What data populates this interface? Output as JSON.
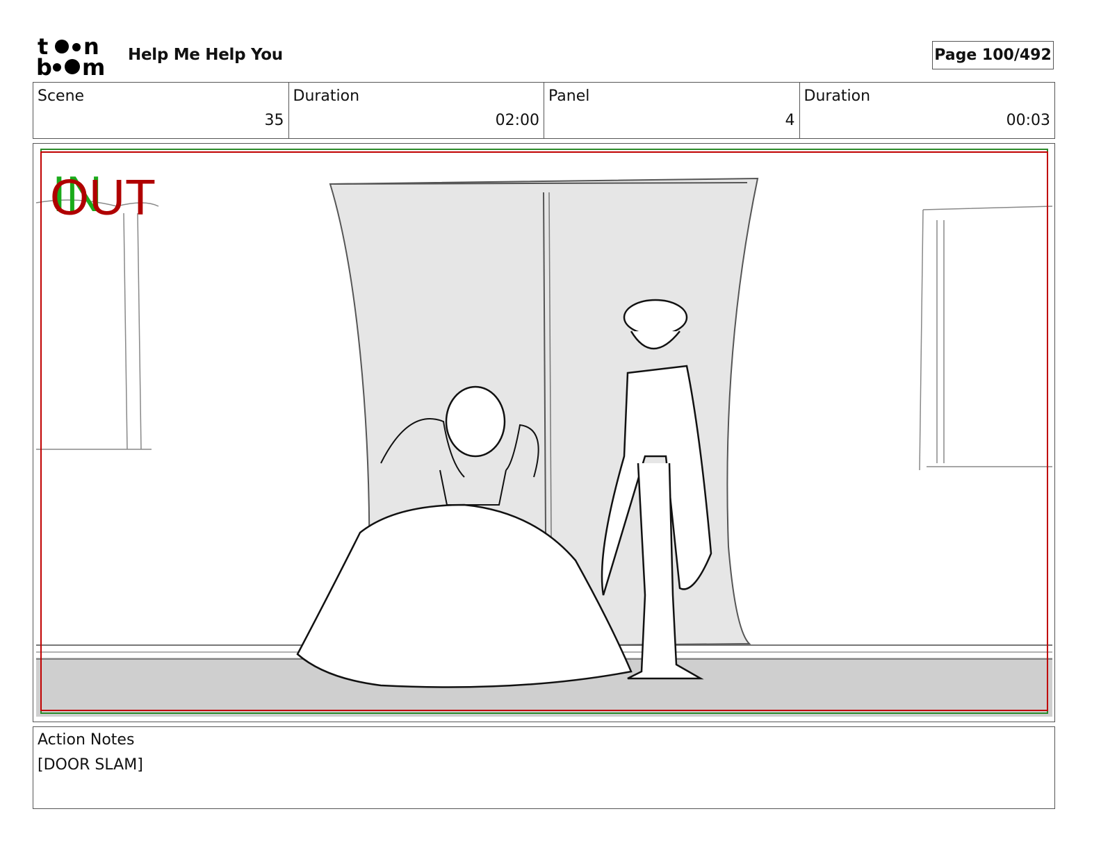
{
  "header": {
    "logo_text": "toon boom",
    "project_title": "Help Me Help You",
    "page_label": "Page 100/492"
  },
  "info": [
    {
      "label": "Scene",
      "value": "35"
    },
    {
      "label": "Duration",
      "value": "02:00"
    },
    {
      "label": "Panel",
      "value": "4"
    },
    {
      "label": "Duration",
      "value": "00:03"
    }
  ],
  "panel": {
    "in_marker": "IN",
    "out_marker": "OUT",
    "colors": {
      "in": "#1aaa1a",
      "out": "#b00000",
      "safe_frame_green": "#2a8a2a",
      "safe_frame_red": "#c00000"
    }
  },
  "notes": {
    "label": "Action Notes",
    "text": "[DOOR SLAM]"
  }
}
